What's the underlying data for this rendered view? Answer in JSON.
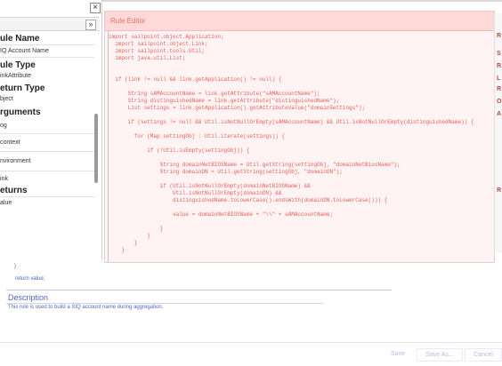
{
  "left_panel": {
    "close_glyph": "×",
    "collapse_glyph": "»",
    "rule_name": {
      "label": "ule Name",
      "value": "IQ Account Name"
    },
    "rule_type": {
      "label": "ule Type",
      "value": "inkAttribute"
    },
    "return_type": {
      "label": "eturn Type",
      "value": "bject"
    },
    "arguments": {
      "label": "rguments",
      "items": [
        "og",
        "context",
        "nvironment",
        "ink"
      ]
    },
    "returns": {
      "label": "eturns",
      "value": "alue"
    }
  },
  "editor": {
    "title": "Rule Editor",
    "lines": [
      "import sailpoint.object.Application;",
      "  import sailpoint.object.Link;",
      "  import sailpoint.tools.Util;",
      "  import java.util.List;",
      "",
      "",
      "  if (link != null && link.getApplication() != null) {",
      "",
      "      String sAMAccountName = link.getAttribute(\"sAMAccountName\");",
      "      String distinguishedName = link.getAttribute(\"distinguishedName\");",
      "      List settings = link.getApplication().getAttributeValue(\"domainSettings\");",
      "",
      "      if (settings != null && Util.isNotNullOrEmpty(sAMAccountName) && Util.isNotNullOrEmpty(distinguishedName)) {",
      "",
      "        for (Map settingObj : Util.iterate(settings)) {",
      "",
      "            if (!Util.isEmpty(settingObj)) {",
      "",
      "                String domainNetBIOSName = Util.getString(settingObj, \"domainNetBiosName\");",
      "                String domainDN = Util.getString(settingObj, \"domainDN\");",
      "",
      "                if (Util.isNotNullOrEmpty(domainNetBIOSName) &&",
      "                    Util.isNotNullOrEmpty(domainDN) &&",
      "                    distinguishedName.toLowerCase().endsWith(domainDN.toLowerCase())) {",
      "",
      "                    value = domainNetBIOSName + \"\\\\\" + sAMAccountName;",
      "",
      "                }",
      "            }",
      "        }",
      "    }"
    ]
  },
  "right_panel": {
    "items": [
      "R",
      "S",
      "R",
      "L",
      "R",
      "O",
      "A",
      "R"
    ]
  },
  "below_editor": {
    "brace": "}",
    "return_statement": "return value;"
  },
  "description": {
    "title": "Description",
    "text": "This rule is used to build a SIQ account name during aggregation."
  },
  "footer": {
    "save": "Save",
    "save_as": "Save As...",
    "cancel": "Cancel"
  },
  "colors": {
    "editor_bg": "#fff3f3",
    "code_text": "#ee5c5c",
    "accent_blue": "#5266c4"
  }
}
